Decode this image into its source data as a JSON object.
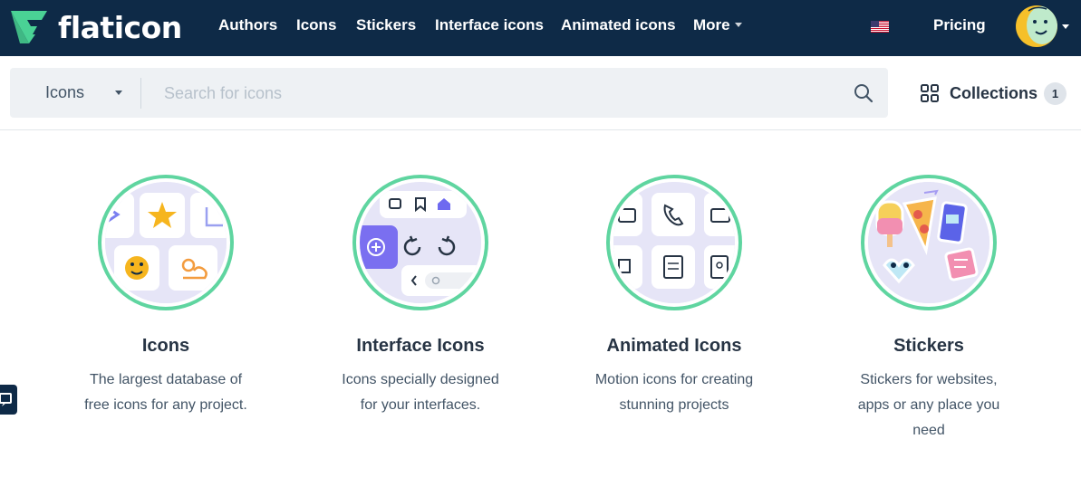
{
  "brand": {
    "name": "flaticon",
    "color_primary": "#0e2a47",
    "color_accent": "#4ad295"
  },
  "nav": {
    "items": [
      "Authors",
      "Icons",
      "Stickers",
      "Interface icons",
      "Animated icons",
      "More"
    ],
    "pricing": "Pricing"
  },
  "search": {
    "type_label": "Icons",
    "placeholder": "Search for icons"
  },
  "collections": {
    "label": "Collections",
    "count": "1"
  },
  "categories": [
    {
      "title": "Icons",
      "description": "The largest database of free icons for any project."
    },
    {
      "title": "Interface Icons",
      "description": "Icons specially designed for your interfaces."
    },
    {
      "title": "Animated Icons",
      "description": "Motion icons for creating stunning projects"
    },
    {
      "title": "Stickers",
      "description": "Stickers for websites, apps or any place you need"
    }
  ]
}
